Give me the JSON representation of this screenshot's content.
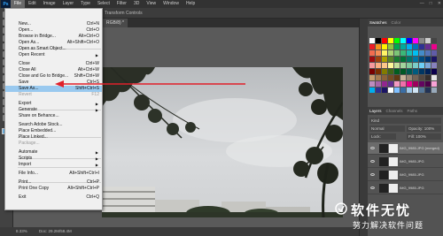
{
  "app": {
    "logo": "Ps",
    "menus": [
      "File",
      "Edit",
      "Image",
      "Layer",
      "Type",
      "Select",
      "Filter",
      "3D",
      "View",
      "Window",
      "Help"
    ],
    "window_controls": [
      "—",
      "□",
      "✕"
    ]
  },
  "options_bar": {
    "text": "Transform Controls"
  },
  "document_tab": {
    "label": "RGB/8) *"
  },
  "file_menu": {
    "items": [
      {
        "label": "New...",
        "shortcut": "Ctrl+N"
      },
      {
        "label": "Open...",
        "shortcut": "Ctrl+O"
      },
      {
        "label": "Browse in Bridge...",
        "shortcut": "Alt+Ctrl+O"
      },
      {
        "label": "Open As...",
        "shortcut": "Alt+Shift+Ctrl+O"
      },
      {
        "label": "Open as Smart Object...",
        "shortcut": ""
      },
      {
        "label": "Open Recent",
        "shortcut": "",
        "submenu": true
      },
      {
        "label": "Close",
        "shortcut": "Ctrl+W"
      },
      {
        "label": "Close All",
        "shortcut": "Alt+Ctrl+W"
      },
      {
        "label": "Close and Go to Bridge...",
        "shortcut": "Shift+Ctrl+W"
      },
      {
        "label": "Save",
        "shortcut": "Ctrl+S"
      },
      {
        "label": "Save As...",
        "shortcut": "Shift+Ctrl+S",
        "highlighted": true
      },
      {
        "label": "Revert",
        "shortcut": "F12",
        "disabled": true
      },
      {
        "label": "Export",
        "shortcut": "",
        "submenu": true
      },
      {
        "label": "Generate",
        "shortcut": "",
        "submenu": true
      },
      {
        "label": "Share on Behance...",
        "shortcut": ""
      },
      {
        "label": "Search Adobe Stock...",
        "shortcut": ""
      },
      {
        "label": "Place Embedded...",
        "shortcut": ""
      },
      {
        "label": "Place Linked...",
        "shortcut": ""
      },
      {
        "label": "Package...",
        "shortcut": "",
        "disabled": true
      },
      {
        "label": "Automate",
        "shortcut": "",
        "submenu": true
      },
      {
        "label": "Scripts",
        "shortcut": "",
        "submenu": true
      },
      {
        "label": "Import",
        "shortcut": "",
        "submenu": true
      },
      {
        "label": "File Info...",
        "shortcut": "Alt+Shift+Ctrl+I"
      },
      {
        "label": "Print...",
        "shortcut": "Ctrl+P"
      },
      {
        "label": "Print One Copy",
        "shortcut": "Alt+Shift+Ctrl+P"
      },
      {
        "label": "Exit",
        "shortcut": "Ctrl+Q"
      }
    ]
  },
  "status_bar": {
    "zoom": "8.33%",
    "doc": "Doc: 29.2M/58.4M"
  },
  "panels": {
    "top_tabs": [
      "Swatches",
      "Color"
    ],
    "layers_tabs": [
      "Layers",
      "Channels",
      "Paths"
    ],
    "kind_label": "Kind",
    "blend_mode": "Normal",
    "opacity": "Opacity: 100%",
    "fill": "Fill: 100%",
    "lock_label": "Lock:",
    "layers": [
      {
        "name": "IMG_9985.JPG (merged)"
      },
      {
        "name": "IMG_9985.JPG"
      },
      {
        "name": "IMG_9985.JPG"
      },
      {
        "name": "IMG_9985.JPG"
      }
    ]
  },
  "watermark": {
    "title": "软件无忧",
    "subtitle": "努力解决软件问题"
  },
  "colors": {
    "highlight": "#99c9ef",
    "annotation_arrow": "#e0202a",
    "foreground": "#6db1e0"
  }
}
